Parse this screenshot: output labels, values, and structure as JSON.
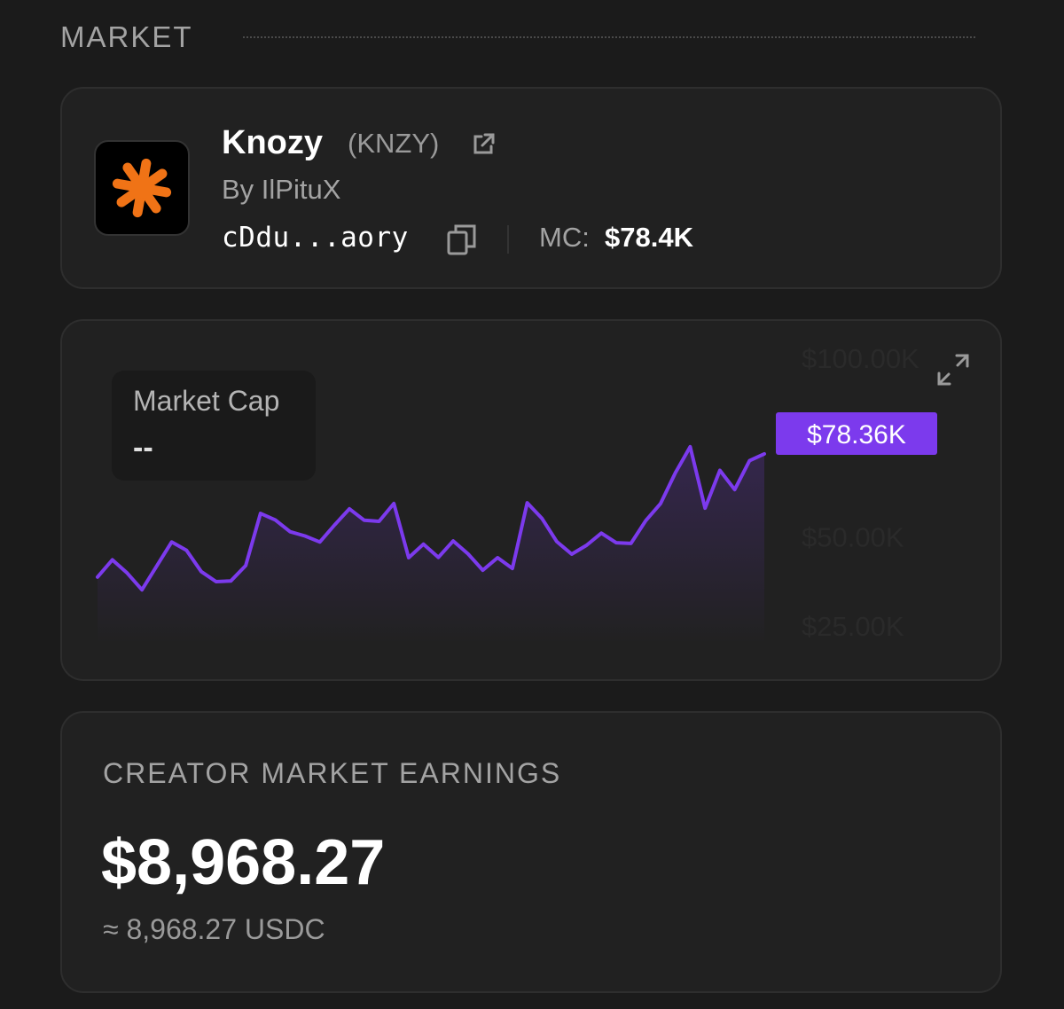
{
  "section": {
    "title": "MARKET"
  },
  "token": {
    "name": "Knozy",
    "symbol": "(KNZY)",
    "creator": "By IlPituX",
    "address": "cDdu...aory",
    "mc_label": "MC:",
    "mc_value": "$78.4K",
    "logo_color": "#f07316"
  },
  "chart": {
    "box_label": "Market Cap",
    "box_value": "--",
    "current_label": "$78.36K",
    "accent": "#7c3aed"
  },
  "chart_data": {
    "type": "line",
    "title": "",
    "xlabel": "",
    "ylabel": "",
    "y_tick_labels": [
      "$100.00K",
      "$50.00K",
      "$25.00K"
    ],
    "ylim": [
      20000,
      105000
    ],
    "current_value": 78360,
    "series": [
      {
        "values": [
          38700,
          43500,
          39800,
          35100,
          41800,
          48500,
          46200,
          40200,
          37400,
          37600,
          41900,
          56500,
          54700,
          51400,
          50200,
          48500,
          53300,
          57800,
          54600,
          54300,
          59300,
          44100,
          47900,
          44200,
          48800,
          45200,
          40600,
          44100,
          41100,
          59500,
          55100,
          48600,
          45100,
          47600,
          51000,
          48300,
          48100,
          54500,
          59300,
          67900,
          75200,
          58000,
          68600,
          63200,
          71300,
          73200
        ]
      }
    ]
  },
  "earnings": {
    "title": "CREATOR MARKET EARNINGS",
    "value": "$8,968.27",
    "sub": "≈ 8,968.27 USDC"
  }
}
